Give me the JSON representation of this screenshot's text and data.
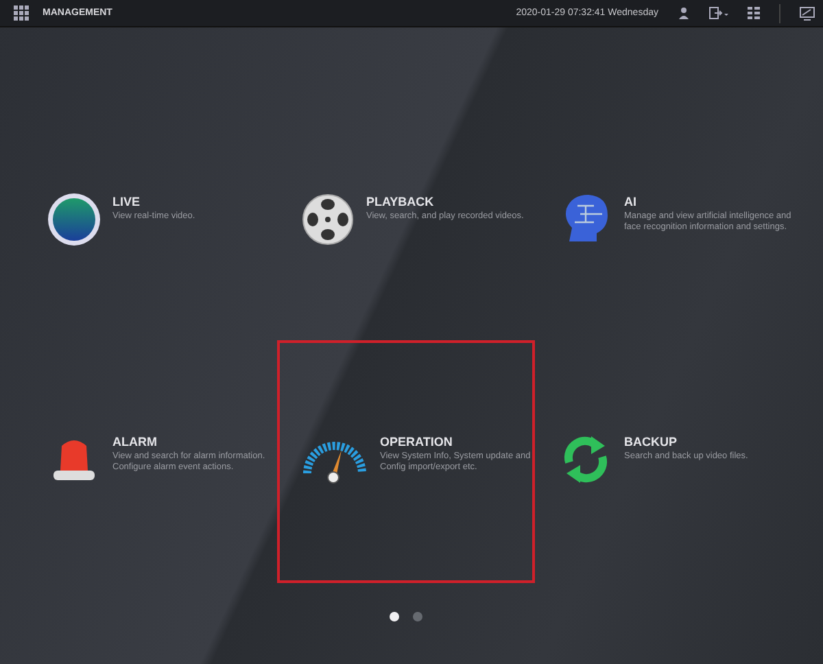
{
  "top_bar": {
    "title": "MANAGEMENT",
    "datetime": "2020-01-29 07:32:41 Wednesday"
  },
  "tiles": [
    {
      "kind": "live",
      "title": "LIVE",
      "description": "View real-time video.",
      "highlighted": false
    },
    {
      "kind": "playback",
      "title": "PLAYBACK",
      "description": "View, search, and play recorded videos.",
      "highlighted": false
    },
    {
      "kind": "ai",
      "title": "AI",
      "description": "Manage and view artificial intelligence and face recognition information and settings.",
      "highlighted": false
    },
    {
      "kind": "alarm",
      "title": "ALARM",
      "description": "View and search for alarm information. Configure alarm event actions.",
      "highlighted": false
    },
    {
      "kind": "operation",
      "title": "OPERATION",
      "description": "View System Info, System update and Config import/export etc.",
      "highlighted": true
    },
    {
      "kind": "backup",
      "title": "BACKUP",
      "description": "Search and back up video files.",
      "highlighted": false
    }
  ],
  "pages": [
    {
      "selected": true
    },
    {
      "selected": false
    }
  ]
}
